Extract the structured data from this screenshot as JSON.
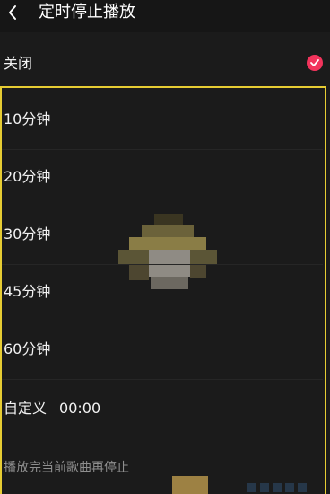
{
  "header": {
    "title": "定时停止播放",
    "back_icon": "chevron-left-icon"
  },
  "close_option": {
    "label": "关闭",
    "selected": true,
    "check_icon": "check-circle-icon",
    "accent_color": "#f2345c"
  },
  "options": [
    {
      "label": "10分钟"
    },
    {
      "label": "20分钟"
    },
    {
      "label": "30分钟"
    },
    {
      "label": "45分钟"
    },
    {
      "label": "60分钟"
    }
  ],
  "custom": {
    "label": "自定义",
    "time": "00:00"
  },
  "footer": {
    "label": "播放完当前歌曲再停止"
  },
  "colors": {
    "background": "#1b1b1b",
    "highlight_border": "#e6cc33",
    "text": "#f2f2f2",
    "muted_text": "#8f8f8f"
  }
}
